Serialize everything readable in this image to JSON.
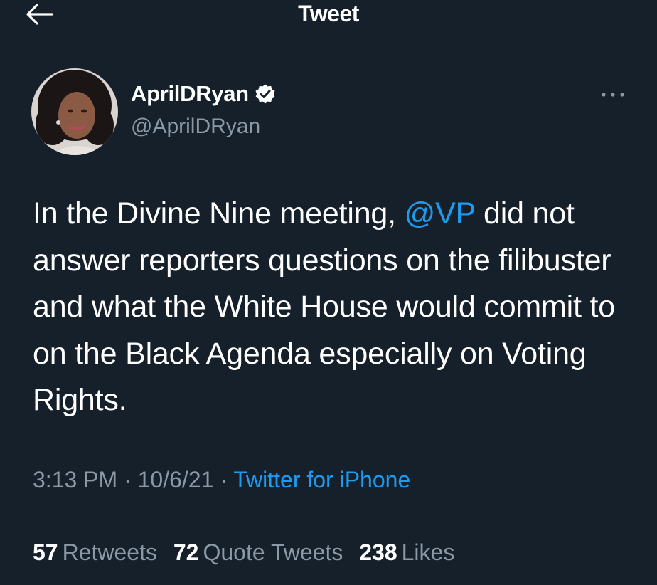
{
  "header": {
    "title": "Tweet",
    "back_icon": "arrow-left-icon"
  },
  "author": {
    "display_name": "AprilDRyan",
    "handle": "@AprilDRyan",
    "verified_icon": "verified-badge-icon",
    "more_icon": "more-dots-icon"
  },
  "tweet": {
    "text_before": "In the Divine Nine meeting, ",
    "mention": "@VP",
    "text_after": " did not answer reporters questions on the filibuster and what the White House would commit to on the Black Agenda especially on Voting Rights."
  },
  "meta": {
    "time": "3:13 PM",
    "sep1": " · ",
    "date": "10/6/21",
    "sep2": " · ",
    "source": "Twitter for iPhone"
  },
  "stats": {
    "retweets_count": "57",
    "retweets_label": "Retweets",
    "quotes_count": "72",
    "quotes_label": "Quote Tweets",
    "likes_count": "238",
    "likes_label": "Likes"
  },
  "colors": {
    "background": "#15202b",
    "accent": "#1d9bf0",
    "secondary_text": "#8b98a5",
    "divider": "#38444d"
  }
}
